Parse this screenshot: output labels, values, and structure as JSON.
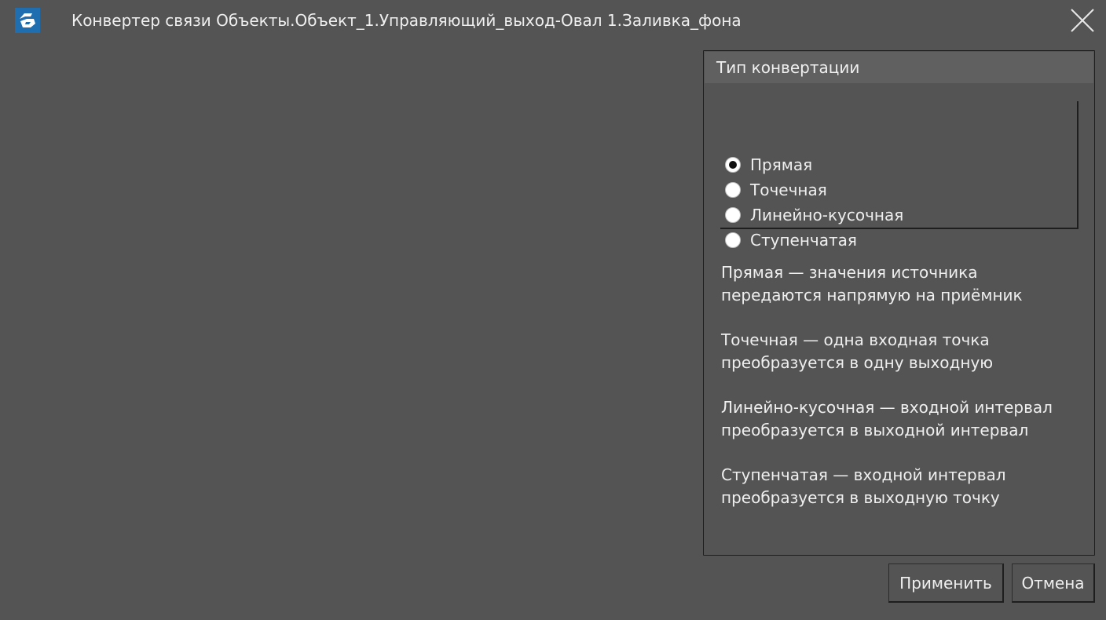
{
  "window": {
    "title": "Конвертер связи Объекты.Объект_1.Управляющий_выход-Овал 1.Заливка_фона",
    "icon": "app-logo-icon",
    "close_icon": "close-icon"
  },
  "conversion_panel": {
    "title": "Тип конвертации",
    "options": [
      {
        "label": "Прямая",
        "checked": true
      },
      {
        "label": "Точечная",
        "checked": false
      },
      {
        "label": "Линейно-кусочная",
        "checked": false
      },
      {
        "label": "Ступенчатая",
        "checked": false
      }
    ],
    "descriptions": [
      {
        "line1": "Прямая — значения источника",
        "line2": "передаются напрямую на приёмник"
      },
      {
        "line1": "Точечная — одна входная точка",
        "line2": "преобразуется в одну выходную"
      },
      {
        "line1": "Линейно-кусочная — входной интервал",
        "line2": "преобразуется в выходной интервал"
      },
      {
        "line1": "Ступенчатая — входной интервал",
        "line2": "преобразуется в выходную точку"
      }
    ]
  },
  "buttons": {
    "apply": "Применить",
    "cancel": "Отмена"
  },
  "colors": {
    "background": "#545454",
    "panel_header": "#606060",
    "text": "#efefef",
    "border": "#1e1e1e",
    "accent_icon": "#1f6fb0"
  }
}
